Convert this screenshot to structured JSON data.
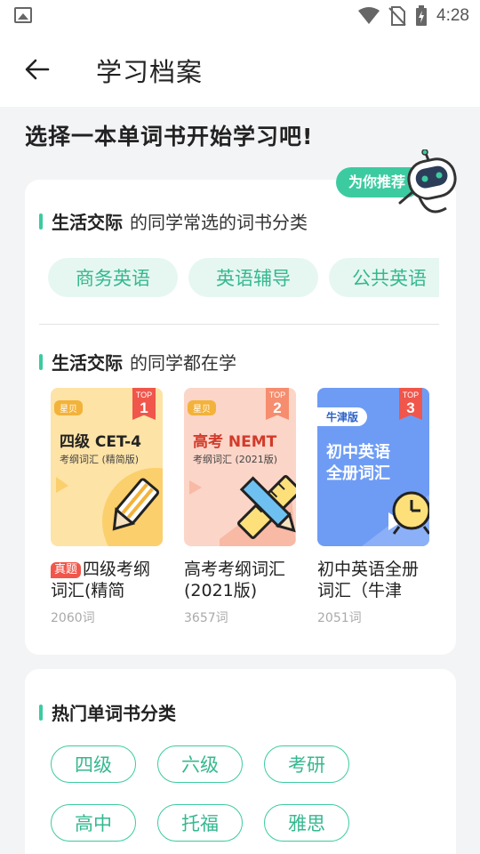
{
  "status_bar": {
    "time": "4:28"
  },
  "app_bar": {
    "title": "学习档案"
  },
  "prompt": "选择一本单词书开始学习吧!",
  "recommend_badge": "为你推荐",
  "categories_section": {
    "highlight": "生活交际",
    "text": "的同学常选的词书分类",
    "pills": [
      "商务英语",
      "英语辅导",
      "公共英语"
    ]
  },
  "popular_section": {
    "highlight": "生活交际",
    "text": "的同学都在学",
    "books": [
      {
        "tag": "真题",
        "name": "四级考纲词汇(精简",
        "count": "2060词",
        "top_label": "TOP",
        "rank": "1",
        "brand": "星贝",
        "cover_title": "四级 CET-4",
        "cover_sub": "考纲词汇 (精简版)",
        "cover_color": "#fde3a6"
      },
      {
        "tag": "",
        "name": "高考考纲词汇(2021版)",
        "count": "3657词",
        "top_label": "TOP",
        "rank": "2",
        "brand": "星贝",
        "cover_title": "高考 NEMT",
        "cover_sub": "考纲词汇 (2021版)",
        "cover_color": "#fbd5c8"
      },
      {
        "tag": "",
        "name": "初中英语全册词汇（牛津",
        "count": "2051词",
        "top_label": "TOP",
        "rank": "3",
        "brand": "牛津版",
        "cover_title": "初中英语",
        "cover_title2": "全册词汇",
        "cover_color": "#6e9cf5"
      }
    ]
  },
  "hot_section": {
    "title": "热门单词书分类",
    "tags": [
      "四级",
      "六级",
      "考研",
      "高中",
      "托福",
      "雅思"
    ]
  },
  "colors": {
    "accent": "#3ccba0",
    "top_badge": "#f0564b"
  }
}
